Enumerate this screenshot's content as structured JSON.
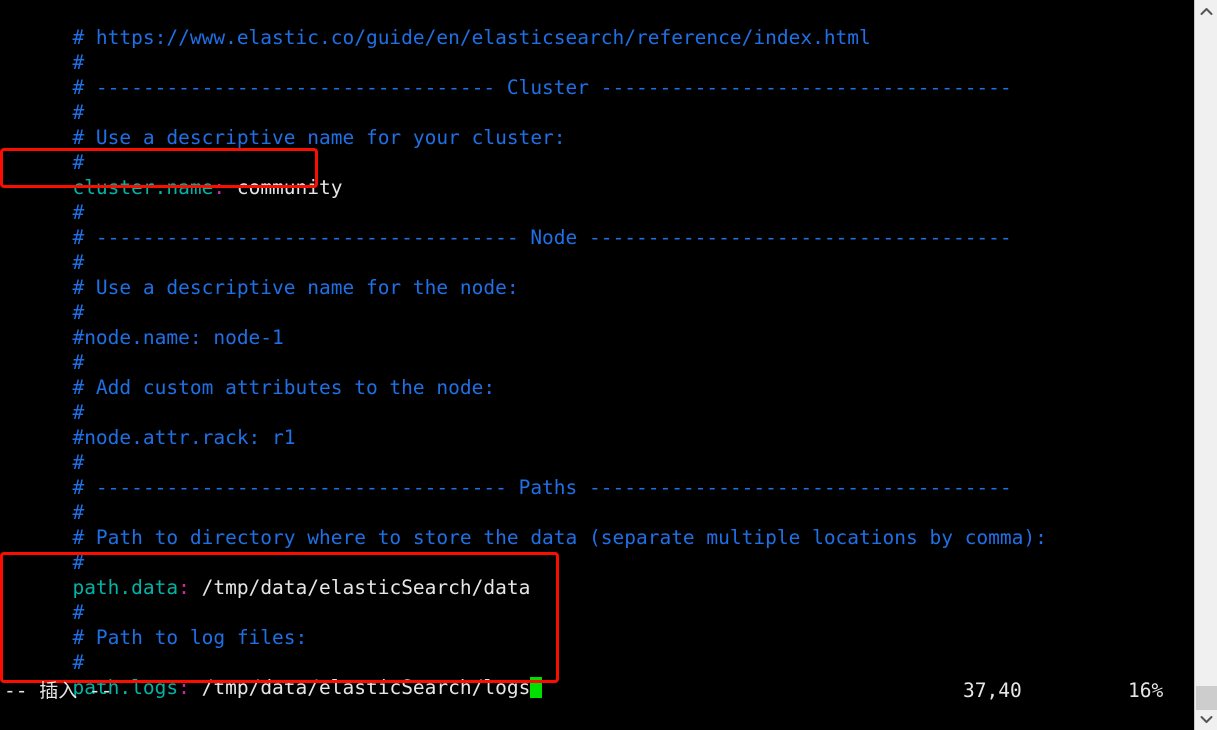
{
  "window": {
    "background_color": "#000000",
    "app": "vim",
    "file_kind": "elasticsearch.yml"
  },
  "colors": {
    "comment": "#1f6fe5",
    "key": "#00b4a8",
    "colon": "#d02aa8",
    "value": "#e6e6e6",
    "cursor": "#00e000",
    "annotation_box": "#fb0d00",
    "scrollbar_track": "#f0f0f0",
    "scrollbar_thumb": "#cdcdcd"
  },
  "editor": {
    "lines": [
      {
        "id": "l01",
        "type": "comment",
        "text": "# https://www.elastic.co/guide/en/elasticsearch/reference/index.html"
      },
      {
        "id": "l02",
        "type": "comment",
        "text": "#"
      },
      {
        "id": "l03",
        "type": "comment",
        "text": "# ---------------------------------- Cluster -----------------------------------"
      },
      {
        "id": "l04",
        "type": "comment",
        "text": "#"
      },
      {
        "id": "l05",
        "type": "comment",
        "text": "# Use a descriptive name for your cluster:"
      },
      {
        "id": "l06",
        "type": "comment",
        "text": "#"
      },
      {
        "id": "l07",
        "type": "setting",
        "key": "cluster.name",
        "colon": ":",
        "value": " community"
      },
      {
        "id": "l08",
        "type": "comment",
        "text": "#"
      },
      {
        "id": "l09",
        "type": "comment",
        "text": "# ------------------------------------ Node ------------------------------------"
      },
      {
        "id": "l10",
        "type": "comment",
        "text": "#"
      },
      {
        "id": "l11",
        "type": "comment",
        "text": "# Use a descriptive name for the node:"
      },
      {
        "id": "l12",
        "type": "comment",
        "text": "#"
      },
      {
        "id": "l13",
        "type": "comment",
        "text": "#node.name: node-1"
      },
      {
        "id": "l14",
        "type": "comment",
        "text": "#"
      },
      {
        "id": "l15",
        "type": "comment",
        "text": "# Add custom attributes to the node:"
      },
      {
        "id": "l16",
        "type": "comment",
        "text": "#"
      },
      {
        "id": "l17",
        "type": "comment",
        "text": "#node.attr.rack: r1"
      },
      {
        "id": "l18",
        "type": "comment",
        "text": "#"
      },
      {
        "id": "l19",
        "type": "comment",
        "text": "# ----------------------------------- Paths ------------------------------------"
      },
      {
        "id": "l20",
        "type": "comment",
        "text": "#"
      },
      {
        "id": "l21",
        "type": "comment",
        "text": "# Path to directory where to store the data (separate multiple locations by comma):"
      },
      {
        "id": "l22",
        "type": "comment",
        "text": "#"
      },
      {
        "id": "l23",
        "type": "setting",
        "key": "path.data",
        "colon": ":",
        "value": " /tmp/data/elasticSearch/data"
      },
      {
        "id": "l24",
        "type": "comment",
        "text": "#"
      },
      {
        "id": "l25",
        "type": "comment",
        "text": "# Path to log files:"
      },
      {
        "id": "l26",
        "type": "comment",
        "text": "#"
      },
      {
        "id": "l27",
        "type": "setting",
        "key": "path.logs",
        "colon": ":",
        "value": " /tmp/data/elasticSearch/logs",
        "cursor": true
      }
    ]
  },
  "annotations": [
    {
      "id": "redbox-cluster",
      "name": "cluster-name-highlight",
      "targets": "cluster.name: community"
    },
    {
      "id": "redbox-paths",
      "name": "paths-highlight",
      "targets": "path.data / path.logs block"
    }
  ],
  "statusline": {
    "mode": "--  插入  --",
    "mode_prefix": "-- ",
    "mode_text": "插入",
    "mode_suffix": " --",
    "position": "37,40",
    "percent": "16%"
  },
  "scrollbar": {
    "up_arrow": "chevron-up-icon",
    "down_arrow": "chevron-down-icon",
    "thumb_position": "near-bottom"
  }
}
